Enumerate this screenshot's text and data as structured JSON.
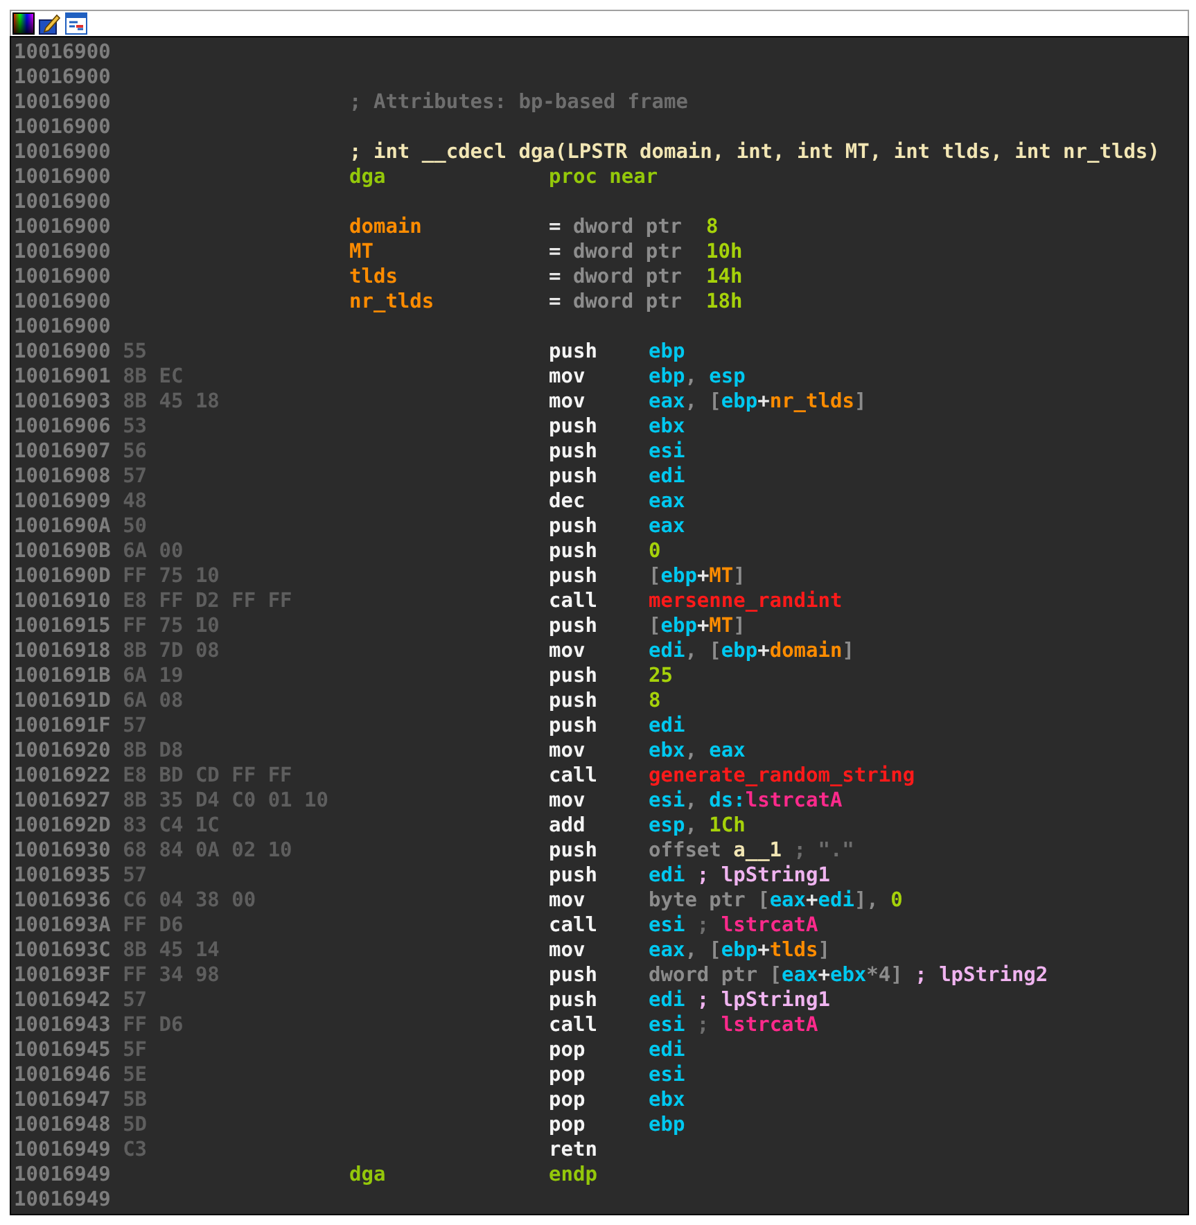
{
  "toolbar": {
    "buttons": [
      {
        "kind": "palette"
      },
      {
        "kind": "edit"
      },
      {
        "kind": "graph"
      }
    ]
  },
  "lines": [
    {
      "address": "10016900"
    },
    {
      "address": "10016900"
    },
    {
      "address": "10016900",
      "comment": {
        "text": "; Attributes: bp-based frame",
        "kind": "comment"
      }
    },
    {
      "address": "10016900"
    },
    {
      "address": "10016900",
      "comment": {
        "text": "; int __cdecl dga(LPSTR domain, int, int MT, int tlds, int nr_tlds)",
        "kind": "prototype"
      }
    },
    {
      "address": "10016900",
      "label": {
        "text": "dga",
        "kind": "keyword"
      },
      "mnemonic": {
        "text": "proc near",
        "kind": "keyword"
      }
    },
    {
      "address": "10016900"
    },
    {
      "address": "10016900",
      "label": {
        "text": "domain",
        "kind": "var"
      },
      "operands": [
        {
          "text": "=",
          "kind": "punct"
        },
        {
          "text": " dword ptr  ",
          "kind": "text"
        },
        {
          "text": "8",
          "kind": "num"
        }
      ]
    },
    {
      "address": "10016900",
      "label": {
        "text": "MT",
        "kind": "var"
      },
      "operands": [
        {
          "text": "=",
          "kind": "punct"
        },
        {
          "text": " dword ptr  ",
          "kind": "text"
        },
        {
          "text": "10h",
          "kind": "num"
        }
      ]
    },
    {
      "address": "10016900",
      "label": {
        "text": "tlds",
        "kind": "var"
      },
      "operands": [
        {
          "text": "=",
          "kind": "punct"
        },
        {
          "text": " dword ptr  ",
          "kind": "text"
        },
        {
          "text": "14h",
          "kind": "num"
        }
      ]
    },
    {
      "address": "10016900",
      "label": {
        "text": "nr_tlds",
        "kind": "var"
      },
      "operands": [
        {
          "text": "=",
          "kind": "punct"
        },
        {
          "text": " dword ptr  ",
          "kind": "text"
        },
        {
          "text": "18h",
          "kind": "num"
        }
      ]
    },
    {
      "address": "10016900"
    },
    {
      "address": "10016900",
      "bytes": "55",
      "mnemonic": {
        "text": "push",
        "kind": "op"
      },
      "operands": [
        {
          "text": "ebp",
          "kind": "reg"
        }
      ]
    },
    {
      "address": "10016901",
      "bytes": "8B EC",
      "mnemonic": {
        "text": "mov",
        "kind": "op"
      },
      "operands": [
        {
          "text": "ebp",
          "kind": "reg"
        },
        {
          "text": ", ",
          "kind": "text"
        },
        {
          "text": "esp",
          "kind": "reg"
        }
      ]
    },
    {
      "address": "10016903",
      "bytes": "8B 45 18",
      "mnemonic": {
        "text": "mov",
        "kind": "op"
      },
      "operands": [
        {
          "text": "eax",
          "kind": "reg"
        },
        {
          "text": ", [",
          "kind": "text"
        },
        {
          "text": "ebp",
          "kind": "reg"
        },
        {
          "text": "+",
          "kind": "punct"
        },
        {
          "text": "nr_tlds",
          "kind": "var"
        },
        {
          "text": "]",
          "kind": "text"
        }
      ]
    },
    {
      "address": "10016906",
      "bytes": "53",
      "mnemonic": {
        "text": "push",
        "kind": "op"
      },
      "operands": [
        {
          "text": "ebx",
          "kind": "reg"
        }
      ]
    },
    {
      "address": "10016907",
      "bytes": "56",
      "mnemonic": {
        "text": "push",
        "kind": "op"
      },
      "operands": [
        {
          "text": "esi",
          "kind": "reg"
        }
      ]
    },
    {
      "address": "10016908",
      "bytes": "57",
      "mnemonic": {
        "text": "push",
        "kind": "op"
      },
      "operands": [
        {
          "text": "edi",
          "kind": "reg"
        }
      ]
    },
    {
      "address": "10016909",
      "bytes": "48",
      "mnemonic": {
        "text": "dec",
        "kind": "op"
      },
      "operands": [
        {
          "text": "eax",
          "kind": "reg"
        }
      ]
    },
    {
      "address": "1001690A",
      "bytes": "50",
      "mnemonic": {
        "text": "push",
        "kind": "op"
      },
      "operands": [
        {
          "text": "eax",
          "kind": "reg"
        }
      ]
    },
    {
      "address": "1001690B",
      "bytes": "6A 00",
      "mnemonic": {
        "text": "push",
        "kind": "op"
      },
      "operands": [
        {
          "text": "0",
          "kind": "num"
        }
      ]
    },
    {
      "address": "1001690D",
      "bytes": "FF 75 10",
      "mnemonic": {
        "text": "push",
        "kind": "op"
      },
      "operands": [
        {
          "text": "[",
          "kind": "text"
        },
        {
          "text": "ebp",
          "kind": "reg"
        },
        {
          "text": "+",
          "kind": "punct"
        },
        {
          "text": "MT",
          "kind": "var"
        },
        {
          "text": "]",
          "kind": "text"
        }
      ]
    },
    {
      "address": "10016910",
      "bytes": "E8 FF D2 FF FF",
      "mnemonic": {
        "text": "call",
        "kind": "op"
      },
      "operands": [
        {
          "text": "mersenne_randint",
          "kind": "func"
        }
      ]
    },
    {
      "address": "10016915",
      "bytes": "FF 75 10",
      "mnemonic": {
        "text": "push",
        "kind": "op"
      },
      "operands": [
        {
          "text": "[",
          "kind": "text"
        },
        {
          "text": "ebp",
          "kind": "reg"
        },
        {
          "text": "+",
          "kind": "punct"
        },
        {
          "text": "MT",
          "kind": "var"
        },
        {
          "text": "]",
          "kind": "text"
        }
      ]
    },
    {
      "address": "10016918",
      "bytes": "8B 7D 08",
      "mnemonic": {
        "text": "mov",
        "kind": "op"
      },
      "operands": [
        {
          "text": "edi",
          "kind": "reg"
        },
        {
          "text": ", [",
          "kind": "text"
        },
        {
          "text": "ebp",
          "kind": "reg"
        },
        {
          "text": "+",
          "kind": "punct"
        },
        {
          "text": "domain",
          "kind": "var"
        },
        {
          "text": "]",
          "kind": "text"
        }
      ]
    },
    {
      "address": "1001691B",
      "bytes": "6A 19",
      "mnemonic": {
        "text": "push",
        "kind": "op"
      },
      "operands": [
        {
          "text": "25",
          "kind": "num"
        }
      ]
    },
    {
      "address": "1001691D",
      "bytes": "6A 08",
      "mnemonic": {
        "text": "push",
        "kind": "op"
      },
      "operands": [
        {
          "text": "8",
          "kind": "num"
        }
      ]
    },
    {
      "address": "1001691F",
      "bytes": "57",
      "mnemonic": {
        "text": "push",
        "kind": "op"
      },
      "operands": [
        {
          "text": "edi",
          "kind": "reg"
        }
      ]
    },
    {
      "address": "10016920",
      "bytes": "8B D8",
      "mnemonic": {
        "text": "mov",
        "kind": "op"
      },
      "operands": [
        {
          "text": "ebx",
          "kind": "reg"
        },
        {
          "text": ", ",
          "kind": "text"
        },
        {
          "text": "eax",
          "kind": "reg"
        }
      ]
    },
    {
      "address": "10016922",
      "bytes": "E8 BD CD FF FF",
      "mnemonic": {
        "text": "call",
        "kind": "op"
      },
      "operands": [
        {
          "text": "generate_random_string",
          "kind": "func"
        }
      ]
    },
    {
      "address": "10016927",
      "bytes": "8B 35 D4 C0 01 10",
      "mnemonic": {
        "text": "mov",
        "kind": "op"
      },
      "operands": [
        {
          "text": "esi",
          "kind": "reg"
        },
        {
          "text": ", ",
          "kind": "text"
        },
        {
          "text": "ds:",
          "kind": "reg"
        },
        {
          "text": "lstrcatA",
          "kind": "import"
        }
      ]
    },
    {
      "address": "1001692D",
      "bytes": "83 C4 1C",
      "mnemonic": {
        "text": "add",
        "kind": "op"
      },
      "operands": [
        {
          "text": "esp",
          "kind": "reg"
        },
        {
          "text": ", ",
          "kind": "text"
        },
        {
          "text": "1Ch",
          "kind": "num"
        }
      ]
    },
    {
      "address": "10016930",
      "bytes": "68 84 0A 02 10",
      "mnemonic": {
        "text": "push",
        "kind": "op"
      },
      "operands": [
        {
          "text": "offset ",
          "kind": "text"
        },
        {
          "text": "a__1",
          "kind": "name"
        },
        {
          "text": " ; \".\"",
          "kind": "comment"
        }
      ]
    },
    {
      "address": "10016935",
      "bytes": "57",
      "mnemonic": {
        "text": "push",
        "kind": "op"
      },
      "operands": [
        {
          "text": "edi",
          "kind": "reg"
        },
        {
          "text": " ; lpString1",
          "kind": "note"
        }
      ]
    },
    {
      "address": "10016936",
      "bytes": "C6 04 38 00",
      "mnemonic": {
        "text": "mov",
        "kind": "op"
      },
      "operands": [
        {
          "text": "byte ptr [",
          "kind": "text"
        },
        {
          "text": "eax",
          "kind": "reg"
        },
        {
          "text": "+",
          "kind": "punct"
        },
        {
          "text": "edi",
          "kind": "reg"
        },
        {
          "text": "], ",
          "kind": "text"
        },
        {
          "text": "0",
          "kind": "num"
        }
      ]
    },
    {
      "address": "1001693A",
      "bytes": "FF D6",
      "mnemonic": {
        "text": "call",
        "kind": "op"
      },
      "operands": [
        {
          "text": "esi",
          "kind": "reg"
        },
        {
          "text": " ; ",
          "kind": "comment"
        },
        {
          "text": "lstrcatA",
          "kind": "import"
        }
      ]
    },
    {
      "address": "1001693C",
      "bytes": "8B 45 14",
      "mnemonic": {
        "text": "mov",
        "kind": "op"
      },
      "operands": [
        {
          "text": "eax",
          "kind": "reg"
        },
        {
          "text": ", [",
          "kind": "text"
        },
        {
          "text": "ebp",
          "kind": "reg"
        },
        {
          "text": "+",
          "kind": "punct"
        },
        {
          "text": "tlds",
          "kind": "var"
        },
        {
          "text": "]",
          "kind": "text"
        }
      ]
    },
    {
      "address": "1001693F",
      "bytes": "FF 34 98",
      "mnemonic": {
        "text": "push",
        "kind": "op"
      },
      "operands": [
        {
          "text": "dword ptr [",
          "kind": "text"
        },
        {
          "text": "eax",
          "kind": "reg"
        },
        {
          "text": "+",
          "kind": "punct"
        },
        {
          "text": "ebx",
          "kind": "reg"
        },
        {
          "text": "*4]",
          "kind": "text"
        },
        {
          "text": " ; lpString2",
          "kind": "note"
        }
      ]
    },
    {
      "address": "10016942",
      "bytes": "57",
      "mnemonic": {
        "text": "push",
        "kind": "op"
      },
      "operands": [
        {
          "text": "edi",
          "kind": "reg"
        },
        {
          "text": " ; lpString1",
          "kind": "note"
        }
      ]
    },
    {
      "address": "10016943",
      "bytes": "FF D6",
      "mnemonic": {
        "text": "call",
        "kind": "op"
      },
      "operands": [
        {
          "text": "esi",
          "kind": "reg"
        },
        {
          "text": " ; ",
          "kind": "comment"
        },
        {
          "text": "lstrcatA",
          "kind": "import"
        }
      ]
    },
    {
      "address": "10016945",
      "bytes": "5F",
      "mnemonic": {
        "text": "pop",
        "kind": "op"
      },
      "operands": [
        {
          "text": "edi",
          "kind": "reg"
        }
      ]
    },
    {
      "address": "10016946",
      "bytes": "5E",
      "mnemonic": {
        "text": "pop",
        "kind": "op"
      },
      "operands": [
        {
          "text": "esi",
          "kind": "reg"
        }
      ]
    },
    {
      "address": "10016947",
      "bytes": "5B",
      "mnemonic": {
        "text": "pop",
        "kind": "op"
      },
      "operands": [
        {
          "text": "ebx",
          "kind": "reg"
        }
      ]
    },
    {
      "address": "10016948",
      "bytes": "5D",
      "mnemonic": {
        "text": "pop",
        "kind": "op"
      },
      "operands": [
        {
          "text": "ebp",
          "kind": "reg"
        }
      ]
    },
    {
      "address": "10016949",
      "bytes": "C3",
      "mnemonic": {
        "text": "retn",
        "kind": "op"
      }
    },
    {
      "address": "10016949",
      "label": {
        "text": "dga",
        "kind": "keyword"
      },
      "mnemonic": {
        "text": "endp",
        "kind": "keyword"
      }
    },
    {
      "address": "10016949"
    }
  ]
}
